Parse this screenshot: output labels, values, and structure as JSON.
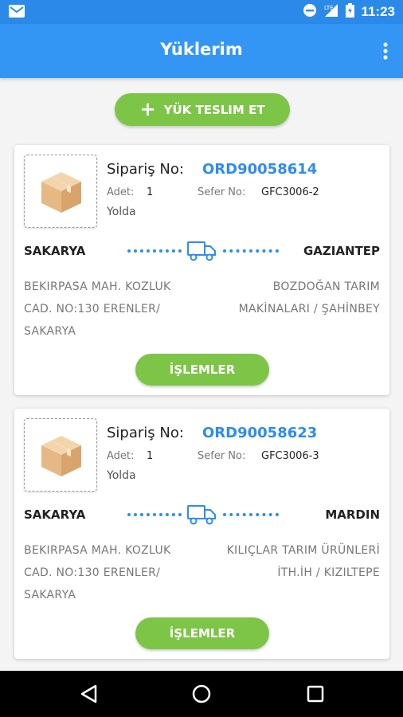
{
  "status_bar": {
    "time": "11:23",
    "network": "LTE"
  },
  "app_bar": {
    "title": "Yüklerim"
  },
  "deliver_button": {
    "label": "YÜK TESLIM ET"
  },
  "orders": [
    {
      "order_label": "Sipariş No:",
      "order_no": "ORD90058614",
      "qty_label": "Adet:",
      "qty": "1",
      "trip_label": "Sefer No:",
      "trip_no": "GFC3006-2",
      "status": "Yolda",
      "from_city": "SAKARYA",
      "to_city": "GAZIANTEP",
      "from_address": "BEKIRPASA MAH. KOZLUK CAD. NO:130 ERENLER/ SAKARYA",
      "to_address": "BOZDOĞAN TARIM MAKİNALARI / ŞAHİNBEY",
      "action_label": "İŞLEMLER"
    },
    {
      "order_label": "Sipariş No:",
      "order_no": "ORD90058623",
      "qty_label": "Adet:",
      "qty": "1",
      "trip_label": "Sefer No:",
      "trip_no": "GFC3006-3",
      "status": "Yolda",
      "from_city": "SAKARYA",
      "to_city": "MARDIN",
      "from_address": "BEKIRPASA MAH. KOZLUK CAD. NO:130 ERENLER/ SAKARYA",
      "to_address": "KILIÇLAR TARIM ÜRÜNLERİ İTH.İH / KIZILTEPE",
      "action_label": "İŞLEMLER"
    }
  ],
  "colors": {
    "primary": "#3396f4",
    "accent": "#7dc547",
    "link": "#2d8cf0"
  }
}
